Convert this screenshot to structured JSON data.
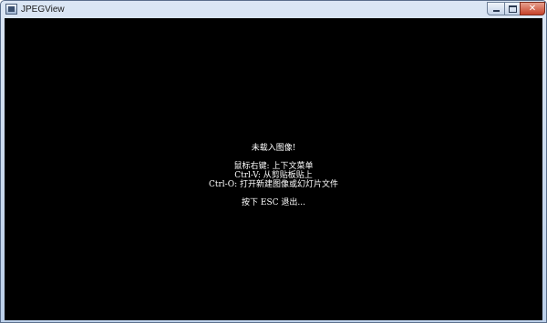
{
  "window": {
    "title": "JPEGView",
    "icons": {
      "app": "app-icon",
      "minimize": "minimize-icon",
      "maximize": "maximize-icon",
      "close": "close-icon"
    },
    "close_glyph": "✕"
  },
  "viewer": {
    "message": {
      "no_image": "未载入图像!",
      "right_click": "鼠标右键: 上下文菜单",
      "ctrl_v": "Ctrl-V: 从剪贴板贴上",
      "ctrl_o": "Ctrl-O: 打开新建图像或幻灯片文件",
      "esc": "按下 ESC 退出..."
    }
  },
  "colors": {
    "background": "#000000",
    "text": "#ffffff",
    "close_button": "#c7422a"
  }
}
